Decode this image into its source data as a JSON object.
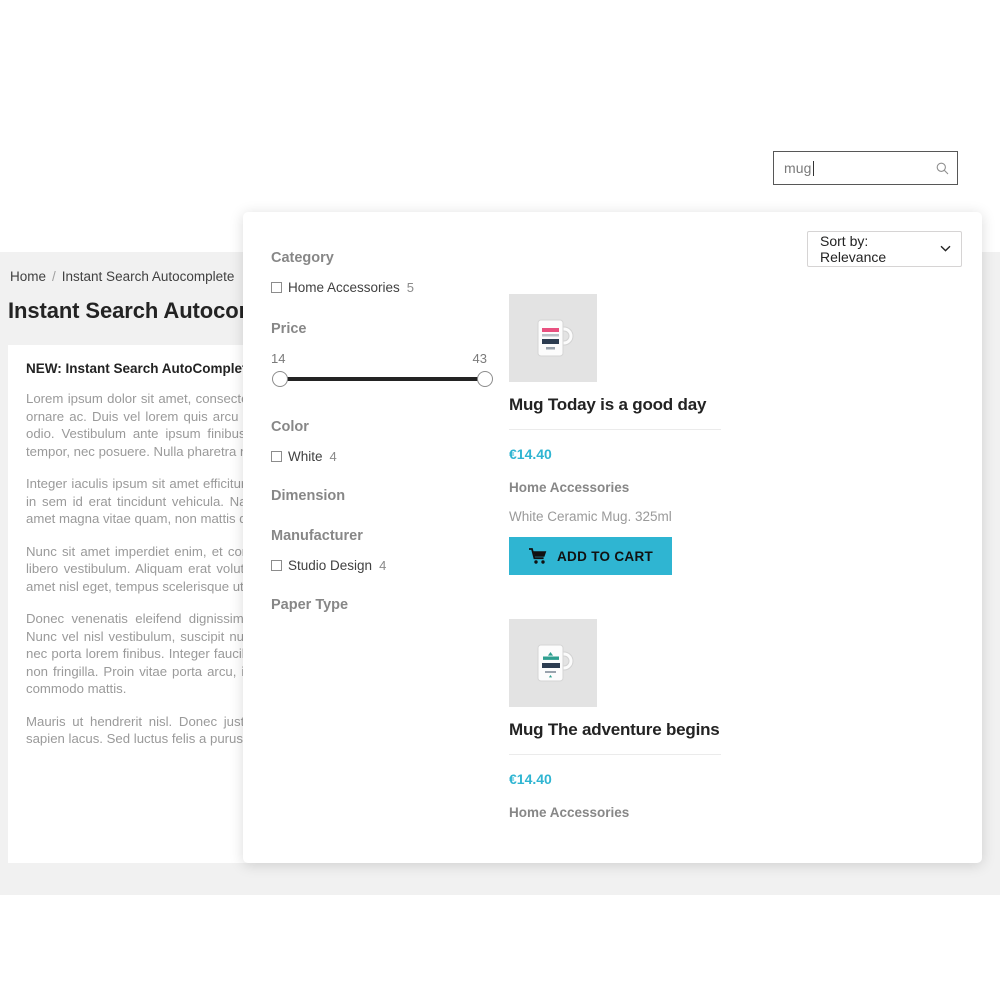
{
  "background_page": {
    "search": {
      "value": "mug",
      "icon": "search-icon"
    },
    "breadcrumb": {
      "home": "Home",
      "separator": "/",
      "current": "Instant Search Autocomplete"
    },
    "page_title": "Instant Search Autocomplete",
    "article": {
      "heading": "NEW: Instant Search AutoComplete",
      "paragraphs": [
        "Lorem ipsum dolor sit amet, consectetur adipiscing elit. Nulla in finibus erat ornare ac. Duis vel lorem quis arcu tincidunt dignissim elit. In nec pretium odio. Vestibulum ante ipsum finibus arcu. Morbi pretium quam ut lorem tempor, nec posuere. Nulla pharetra non diam nec ultricies.",
        "Integer iaculis ipsum sit amet efficitur sagittis. Sed vitae pharetra. Curabitur in sem id erat tincidunt vehicula. Nam porta dolor euismod ac. Donec sit amet magna vitae quam, non mattis diam. Quisque volutpat nisl ut sapien.",
        "Nunc sit amet imperdiet enim, et consequat arcu. Integer posuere facilisis libero vestibulum. Aliquam erat volutpat. Donec massa risus, dignissim sit amet nisl eget, tempus scelerisque ut.",
        "Donec venenatis eleifend dignissim. Vivamus non tellus lacinia vel est. Nunc vel nisl vestibulum, suscipit nunc quis, ante sit amet neque sodales, nec porta lorem finibus. Integer faucibus tortor ac scelerisque tempus. Nam non fringilla. Proin vitae porta arcu, in congue mi. Mauris tempus vel nulla commodo mattis.",
        "Mauris ut hendrerit nisl. Donec justo metus, ornare sit nisl. Fusce vitae sapien lacus. Sed luctus felis a purus blandit in turpis ac sagittis."
      ]
    }
  },
  "overlay": {
    "sort": {
      "label": "Sort by: Relevance",
      "chevron": "⌄"
    },
    "filters": [
      {
        "title": "Category",
        "type": "checkbox",
        "options": [
          {
            "label": "Home Accessories",
            "count": "5",
            "checked": false
          }
        ]
      },
      {
        "title": "Price",
        "type": "range",
        "min": "14",
        "max": "43"
      },
      {
        "title": "Color",
        "type": "checkbox",
        "options": [
          {
            "label": "White",
            "count": "4",
            "checked": false
          }
        ]
      },
      {
        "title": "Dimension",
        "type": "checkbox",
        "options": []
      },
      {
        "title": "Manufacturer",
        "type": "checkbox",
        "options": [
          {
            "label": "Studio Design",
            "count": "4",
            "checked": false
          }
        ]
      },
      {
        "title": "Paper Type",
        "type": "checkbox",
        "options": []
      }
    ],
    "products": [
      {
        "name": "Mug Today is a good day",
        "price": "€14.40",
        "category": "Home Accessories",
        "description": "White Ceramic Mug. 325ml",
        "add_to_cart_label": "ADD TO CART",
        "cart_icon": "shopping-cart-icon",
        "thumb_icon": "mug-today-is-a-good-day-image",
        "thumb_text_lines": [
          "TODAY",
          "IS A",
          "GOOD",
          "DAY"
        ],
        "thumb_accent": "#e8507f"
      },
      {
        "name": "Mug The adventure begins",
        "price": "€14.40",
        "category": "Home Accessories",
        "description": "",
        "add_to_cart_label": "",
        "cart_icon": "",
        "thumb_icon": "mug-the-adventure-begins-image",
        "thumb_text_lines": [
          "The",
          "Adventure",
          "BEGINS"
        ],
        "thumb_accent": "#2e9e8f"
      }
    ]
  },
  "colors": {
    "accent": "#2fb5d2",
    "page_bg": "#f1f1f1",
    "text": "#232323",
    "muted": "#9a9a9a"
  }
}
